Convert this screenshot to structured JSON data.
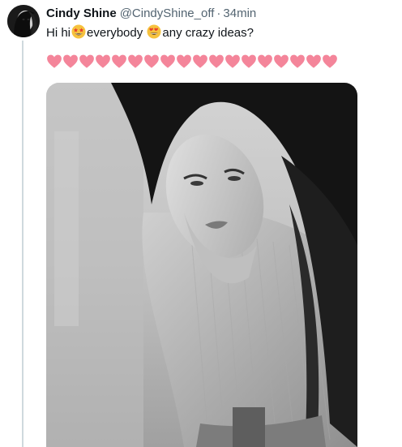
{
  "tweet": {
    "display_name": "Cindy Shine",
    "handle": "@CindyShine_off",
    "separator": "·",
    "time": "34min",
    "text_part1": "Hi hi",
    "text_part2": "everybody",
    "text_part3": "any crazy ideas?",
    "emoji_1": "star-struck-emoji",
    "emoji_2": "heart-eyes-emoji",
    "heart_count": 18,
    "heart_color": "#f4859a"
  },
  "colors": {
    "text_primary": "#0f1419",
    "text_secondary": "#536471",
    "thread_line": "#cfd9de"
  }
}
